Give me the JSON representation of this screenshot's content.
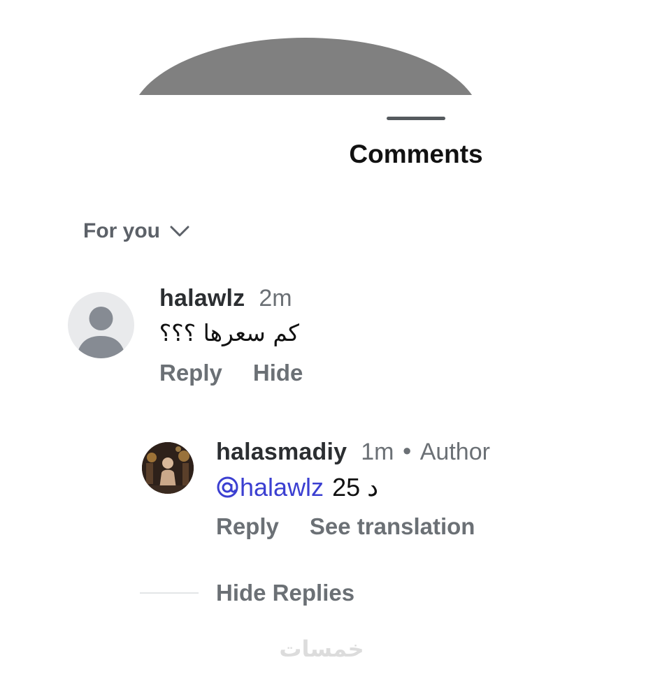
{
  "sheet": {
    "title": "Comments",
    "filter_label": "For you"
  },
  "comments": [
    {
      "username": "halawlz",
      "time": "2m",
      "text": "كم سعرها ؟؟؟",
      "actions": [
        "Reply",
        "Hide"
      ]
    }
  ],
  "replies": [
    {
      "username": "halasmadiy",
      "time": "1m",
      "author_badge": "Author",
      "mention": "halawlz",
      "text": "د 25",
      "actions": [
        "Reply",
        "See translation"
      ]
    }
  ],
  "hide_replies_label": "Hide Replies",
  "watermark": "خمسات",
  "colors": {
    "mention": "#3b3fd1",
    "muted_text": "#6b7075",
    "primary_text": "#111111"
  }
}
